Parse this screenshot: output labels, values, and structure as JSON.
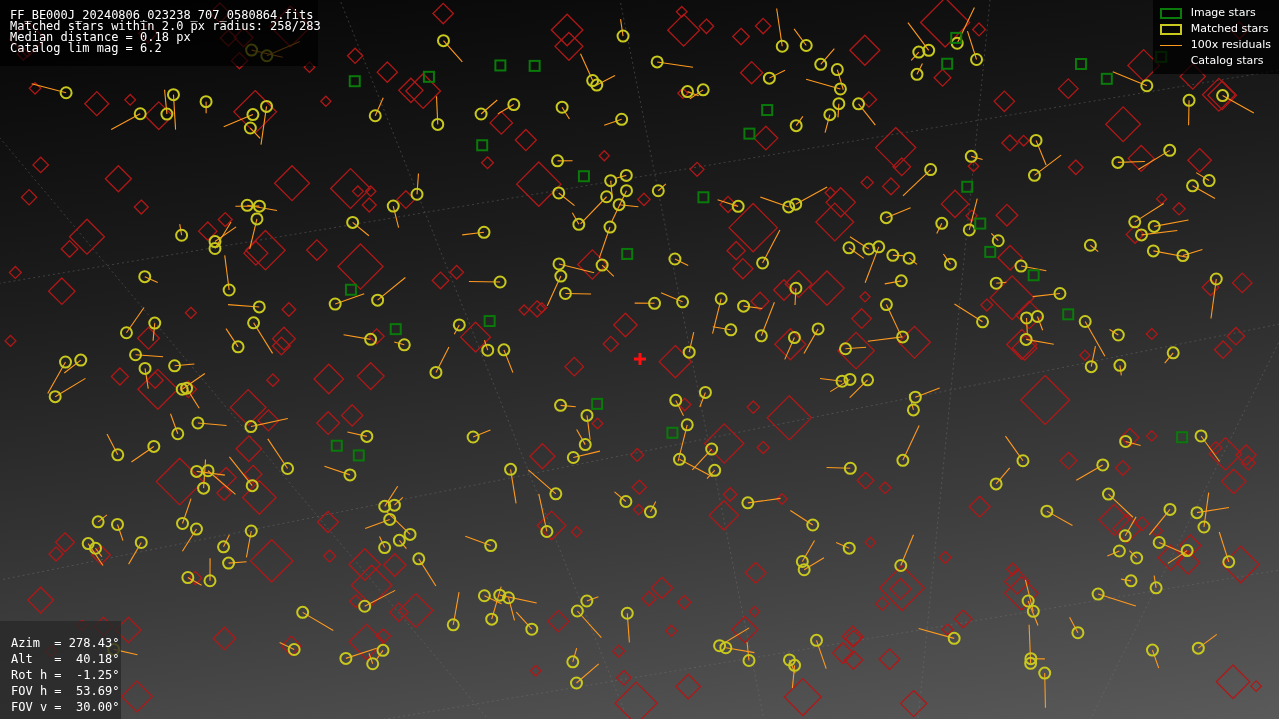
{
  "file_info": {
    "lines": [
      "FF_BE000J_20240806_023238_707_0580864.fits",
      "Matched stars within 2.0 px radius: 258/283",
      "Median distance = 0.18 px",
      "Catalog lim mag = 6.2"
    ]
  },
  "legend": [
    {
      "kind": "box",
      "color": "#0a7a0a",
      "label": "Image stars"
    },
    {
      "kind": "box",
      "color": "#c8c81e",
      "label": "Matched stars"
    },
    {
      "kind": "line",
      "color": "#ff9a1e",
      "label": "100x residuals"
    },
    {
      "kind": "none",
      "label": "Catalog stars"
    }
  ],
  "pointing": {
    "lines": [
      "Azim  = 278.43°",
      "Alt   =  40.18°",
      "Rot h =  -1.25°",
      "FOV h =  53.69°",
      "FOV v =  30.00°"
    ]
  }
}
